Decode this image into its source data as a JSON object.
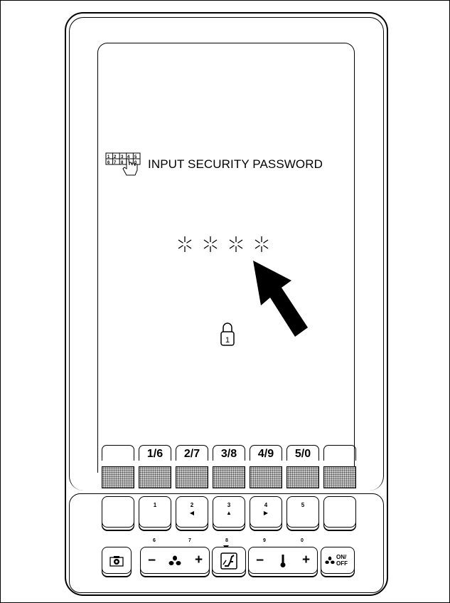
{
  "screen": {
    "title": "INPUT SECURITY PASSWORD",
    "password_mask": [
      "*",
      "*",
      "*",
      "*"
    ],
    "icons": [
      "keypad-hand-icon",
      "padlock-icon",
      "pointer-arrow-icon"
    ]
  },
  "softkeys": [
    "",
    "1/6",
    "2/7",
    "3/8",
    "4/9",
    "5/0",
    ""
  ],
  "hardkeys": [
    {
      "label": "",
      "sub": ""
    },
    {
      "label": "1",
      "sub": ""
    },
    {
      "label": "2",
      "sub": "◀"
    },
    {
      "label": "3",
      "sub": "▲"
    },
    {
      "label": "4",
      "sub": "▶"
    },
    {
      "label": "5",
      "sub": ""
    },
    {
      "label": "",
      "sub": ""
    }
  ],
  "bottom_numbers": {
    "n6": "6",
    "n7": "7",
    "n8": "8",
    "n9": "9",
    "n0": "0"
  },
  "controls": {
    "fan_minus": "−",
    "fan_plus": "+",
    "temp_minus": "−",
    "temp_plus": "+",
    "power_label": "ON/ OFF",
    "camera_icon": "camera-icon",
    "fan_icon": "fan-icon",
    "thermometer_icon": "thermometer-icon",
    "seat_icon": "seat-recline-icon"
  }
}
